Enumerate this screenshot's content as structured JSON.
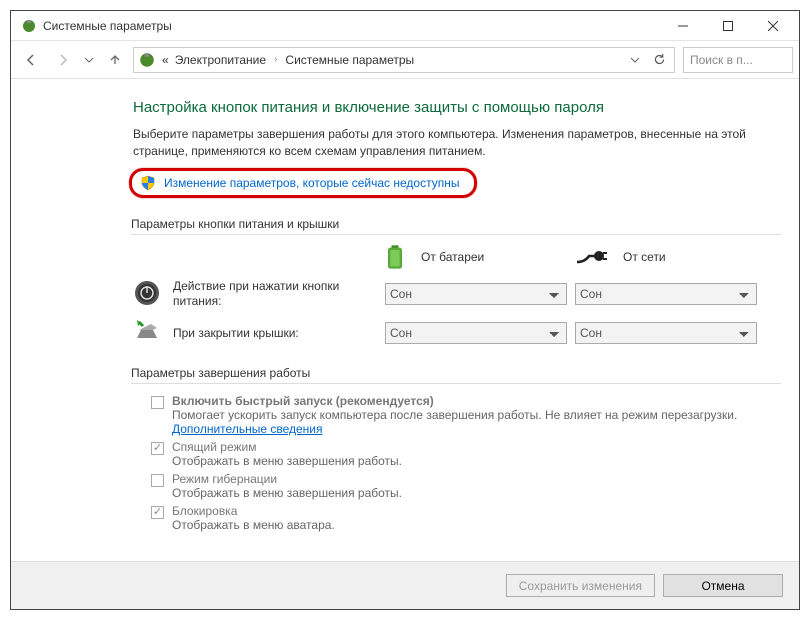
{
  "window": {
    "title": "Системные параметры"
  },
  "breadcrumb": {
    "prefix": "«",
    "lvl1": "Электропитание",
    "lvl2": "Системные параметры"
  },
  "search": {
    "placeholder": "Поиск в п..."
  },
  "page": {
    "heading": "Настройка кнопок питания и включение защиты с помощью пароля",
    "intro": "Выберите параметры завершения работы для этого компьютера. Изменения параметров, внесенные на этой странице, применяются ко всем схемам управления питанием.",
    "callout_link": "Изменение параметров, которые сейчас недоступны"
  },
  "power": {
    "section_title": "Параметры кнопки питания и крышки",
    "col_battery": "От батареи",
    "col_ac": "От сети",
    "row1_label": "Действие при нажатии кнопки питания:",
    "row2_label": "При закрытии крышки:",
    "select_value": "Сон"
  },
  "shutdown": {
    "section_title": "Параметры завершения работы",
    "items": [
      {
        "checked": false,
        "title": "Включить быстрый запуск (рекомендуется)",
        "bold": true,
        "desc": "Помогает ускорить запуск компьютера после завершения работы. Не влияет на режим перезагрузки. ",
        "link": "Дополнительные сведения"
      },
      {
        "checked": true,
        "title": "Спящий режим",
        "bold": false,
        "desc": "Отображать в меню завершения работы.",
        "link": ""
      },
      {
        "checked": false,
        "title": "Режим гибернации",
        "bold": false,
        "desc": "Отображать в меню завершения работы.",
        "link": ""
      },
      {
        "checked": true,
        "title": "Блокировка",
        "bold": false,
        "desc": "Отображать в меню аватара.",
        "link": ""
      }
    ]
  },
  "footer": {
    "save": "Сохранить изменения",
    "cancel": "Отмена"
  }
}
